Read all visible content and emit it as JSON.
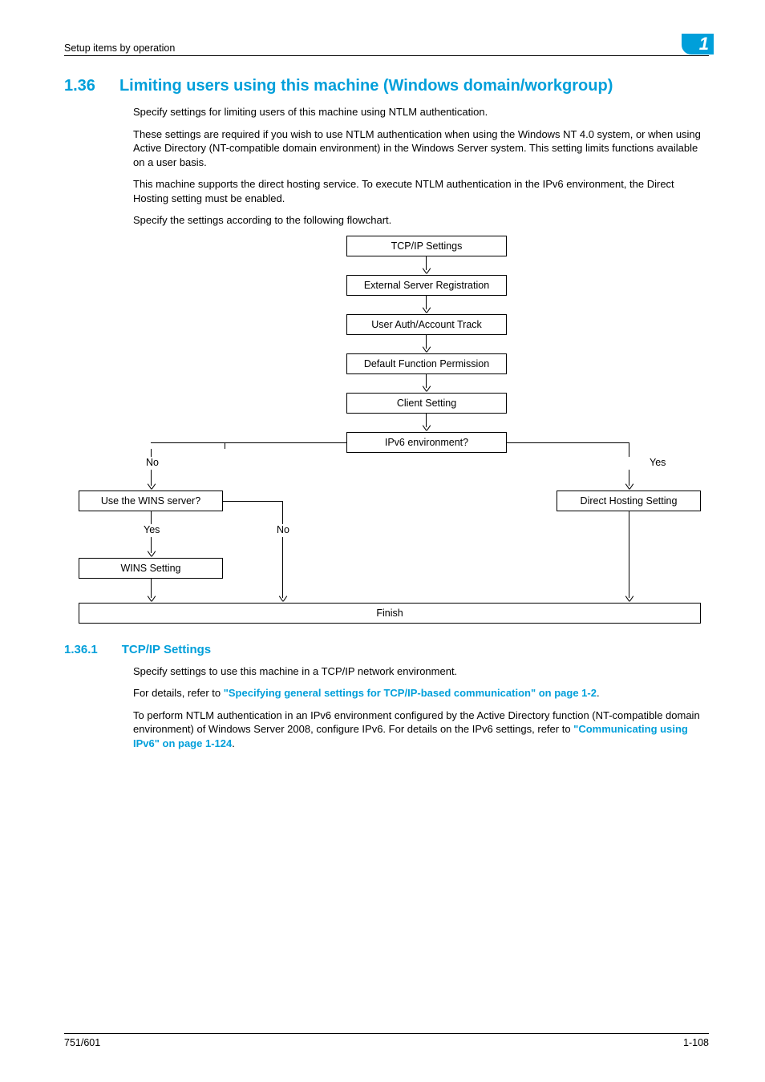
{
  "running_head": "Setup items by operation",
  "chapter_tab": "1",
  "h1": {
    "num": "1.36",
    "title": "Limiting users using this machine (Windows domain/workgroup)"
  },
  "intro": {
    "p1": "Specify settings for limiting users of this machine using NTLM authentication.",
    "p2": "These settings are required if you wish to use NTLM authentication when using the Windows NT 4.0 system, or when using Active Directory (NT-compatible domain environment) in the Windows Server system. This setting limits functions available on a user basis.",
    "p3": "This machine supports the direct hosting service. To execute NTLM authentication in the IPv6 environment, the Direct Hosting setting must be enabled.",
    "p4": "Specify the settings according to the following flowchart."
  },
  "flowchart": {
    "tcpip": "TCP/IP Settings",
    "ext_srv": "External Server Registration",
    "user_auth": "User Auth/Account Track",
    "def_perm": "Default Function Permission",
    "client": "Client Setting",
    "ipv6_q": "IPv6 environment?",
    "no": "No",
    "yes": "Yes",
    "wins_q": "Use the WINS server?",
    "direct_hosting": "Direct Hosting Setting",
    "yes2": "Yes",
    "no2": "No",
    "wins_setting": "WINS Setting",
    "finish": "Finish"
  },
  "h2": {
    "num": "1.36.1",
    "title": "TCP/IP Settings"
  },
  "sec": {
    "p1": "Specify settings to use this machine in a TCP/IP network environment.",
    "p2_a": "For details, refer to ",
    "p2_link": "\"Specifying general settings for TCP/IP-based communication\" on page 1-2",
    "p2_b": ".",
    "p3_a": "To perform NTLM authentication in an IPv6 environment configured by the Active Directory function (NT-compatible domain environment) of Windows Server 2008, configure IPv6. For details on the IPv6 settings, refer to ",
    "p3_link": "\"Communicating using IPv6\" on page 1-124",
    "p3_b": "."
  },
  "footer": {
    "left": "751/601",
    "right": "1-108"
  },
  "chart_data": {
    "type": "flowchart",
    "nodes": [
      {
        "id": "tcpip",
        "label": "TCP/IP Settings",
        "type": "process"
      },
      {
        "id": "ext_srv",
        "label": "External Server Registration",
        "type": "process"
      },
      {
        "id": "user_auth",
        "label": "User Auth/Account Track",
        "type": "process"
      },
      {
        "id": "def_perm",
        "label": "Default Function Permission",
        "type": "process"
      },
      {
        "id": "client",
        "label": "Client Setting",
        "type": "process"
      },
      {
        "id": "ipv6_q",
        "label": "IPv6 environment?",
        "type": "decision"
      },
      {
        "id": "wins_q",
        "label": "Use the WINS server?",
        "type": "decision"
      },
      {
        "id": "direct_hosting",
        "label": "Direct Hosting Setting",
        "type": "process"
      },
      {
        "id": "wins_setting",
        "label": "WINS Setting",
        "type": "process"
      },
      {
        "id": "finish",
        "label": "Finish",
        "type": "terminator"
      }
    ],
    "edges": [
      {
        "from": "tcpip",
        "to": "ext_srv"
      },
      {
        "from": "ext_srv",
        "to": "user_auth"
      },
      {
        "from": "user_auth",
        "to": "def_perm"
      },
      {
        "from": "def_perm",
        "to": "client"
      },
      {
        "from": "client",
        "to": "ipv6_q"
      },
      {
        "from": "ipv6_q",
        "to": "wins_q",
        "label": "No"
      },
      {
        "from": "ipv6_q",
        "to": "direct_hosting",
        "label": "Yes"
      },
      {
        "from": "wins_q",
        "to": "wins_setting",
        "label": "Yes"
      },
      {
        "from": "wins_q",
        "to": "finish",
        "label": "No"
      },
      {
        "from": "wins_setting",
        "to": "finish"
      },
      {
        "from": "direct_hosting",
        "to": "finish"
      }
    ]
  }
}
